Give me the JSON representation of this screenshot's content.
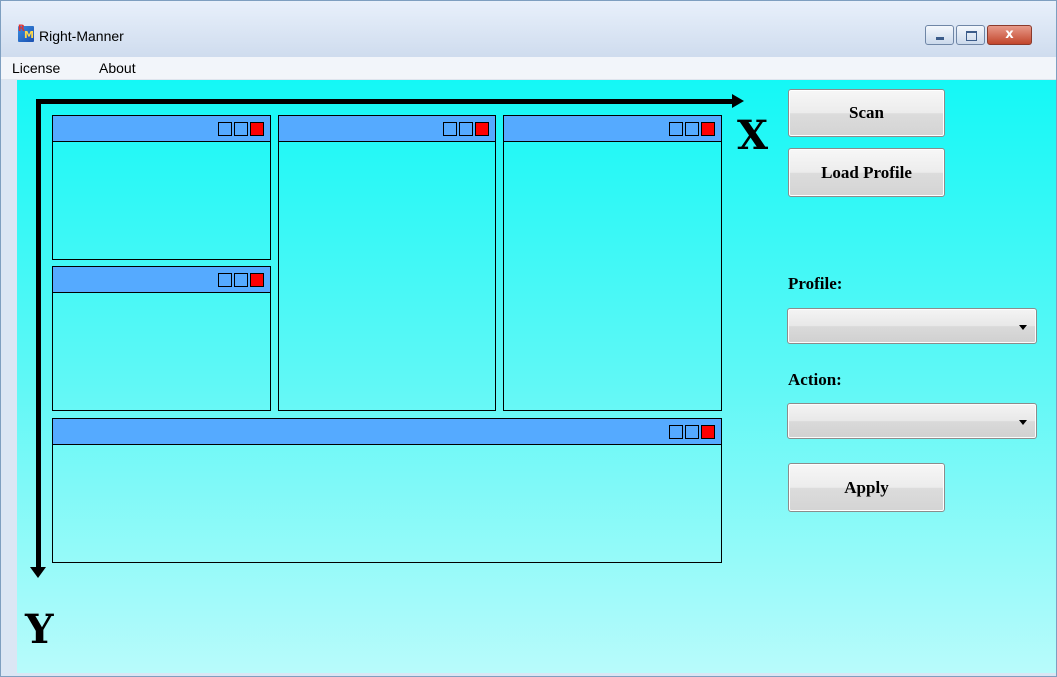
{
  "window": {
    "title": "Right-Manner",
    "icon": "app-logo-icon",
    "icon_letters": [
      "R",
      "M"
    ],
    "controls": {
      "minimize_icon": "minimize-icon",
      "maximize_icon": "maximize-icon",
      "close_icon": "close-icon",
      "close_glyph": "x"
    }
  },
  "menu": {
    "items": [
      {
        "label": "License"
      },
      {
        "label": "About"
      }
    ]
  },
  "canvas": {
    "background_top": "#14f8f6",
    "background_bottom": "#b8fbfb",
    "axis_x_label": "X",
    "axis_y_label": "Y",
    "mock_window_titlebar_color": "#55aaff",
    "mock_window_close_color": "#ff0000",
    "mock_window_count": 5
  },
  "panel": {
    "scan_label": "Scan",
    "load_profile_label": "Load Profile",
    "profile_label": "Profile:",
    "profile_value": "",
    "action_label": "Action:",
    "action_value": "",
    "apply_label": "Apply"
  }
}
